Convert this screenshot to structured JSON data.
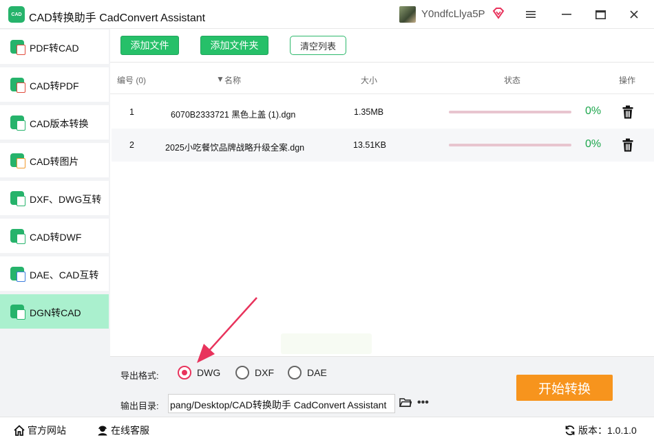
{
  "app": {
    "title": "CAD转换助手 CadConvert Assistant",
    "logo_text": "CAD",
    "username": "Y0ndfcLlya5P"
  },
  "window_controls": [
    "menu-icon",
    "minimize-icon",
    "maximize-icon",
    "close-icon"
  ],
  "sidebar": {
    "items": [
      {
        "label": "PDF转CAD",
        "active": false
      },
      {
        "label": "CAD转PDF",
        "active": false
      },
      {
        "label": "CAD版本转换",
        "active": false
      },
      {
        "label": "CAD转图片",
        "active": false
      },
      {
        "label": "DXF、DWG互转",
        "active": false
      },
      {
        "label": "CAD转DWF",
        "active": false
      },
      {
        "label": "DAE、CAD互转",
        "active": false
      },
      {
        "label": "DGN转CAD",
        "active": true
      }
    ]
  },
  "toolbar": {
    "add_file": "添加文件",
    "add_folder": "添加文件夹",
    "clear_list": "清空列表"
  },
  "table": {
    "headers": {
      "index": "编号 (0)",
      "name": "名称",
      "size": "大小",
      "status": "状态",
      "action": "操作"
    },
    "rows": [
      {
        "index": "1",
        "name": "6070B2333721 黑色上盖 (1).dgn",
        "size": "1.35MB",
        "progress": 0,
        "percent_text": "0%"
      },
      {
        "index": "2",
        "name": "2025小吃餐饮品牌战略升级全案.dgn",
        "size": "13.51KB",
        "progress": 0,
        "percent_text": "0%"
      }
    ]
  },
  "output": {
    "format_label": "导出格式:",
    "formats": [
      {
        "label": "DWG",
        "checked": true
      },
      {
        "label": "DXF",
        "checked": false
      },
      {
        "label": "DAE",
        "checked": false
      }
    ],
    "dir_label": "输出目录:",
    "dir_value": "pang/Desktop/CAD转换助手 CadConvert Assistant",
    "start_button": "开始转换"
  },
  "statusbar": {
    "website": "官方网站",
    "support": "在线客服",
    "version": "版本：1.0.1.0"
  },
  "colors": {
    "accent_green": "#26c069",
    "active_sidebar": "#aaf0ce",
    "start_orange": "#f7941d",
    "radio_checked": "#e8335c",
    "percent_green": "#1ca64c"
  }
}
